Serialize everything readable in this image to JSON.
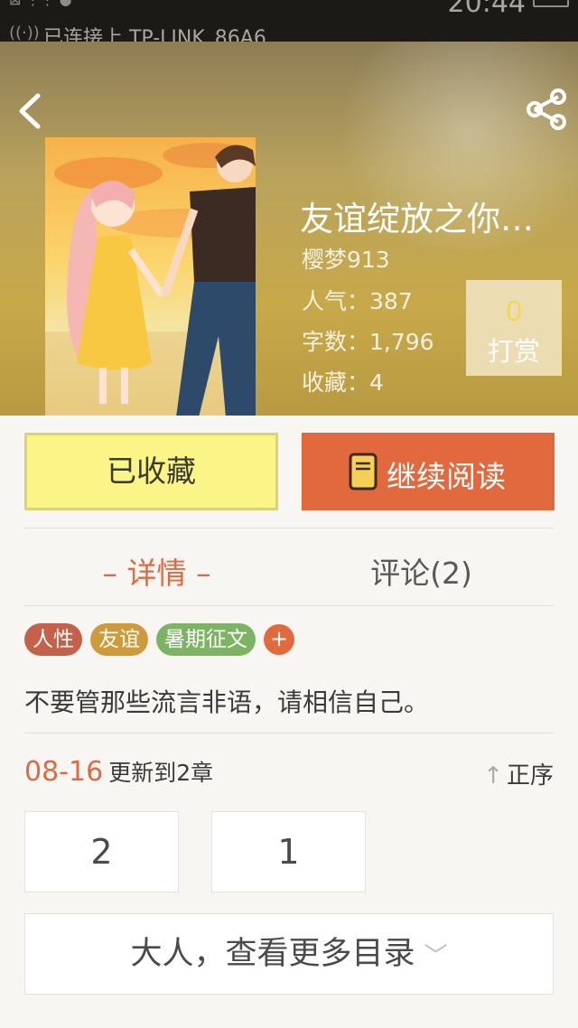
{
  "status_bar": {
    "wifi_text": "已连接上 TP-LINK_86A6",
    "time": "20:44"
  },
  "header": {
    "book_title": "友谊绽放之你…",
    "author": "樱梦913",
    "popularity_label": "人气：",
    "popularity_value": "387",
    "words_label": "字数：",
    "words_value": "1,796",
    "favorites_label": "收藏：",
    "favorites_value": "4",
    "tip_count": "0",
    "tip_label": "打赏"
  },
  "actions": {
    "collected_label": "已收藏",
    "continue_label": "继续阅读"
  },
  "tabs": {
    "details": "– 详情 –",
    "comments": "评论(2)"
  },
  "tags": [
    {
      "label": "人性",
      "color": "#c5604a"
    },
    {
      "label": "友谊",
      "color": "#cd9a3c"
    },
    {
      "label": "暑期征文",
      "color": "#7db464"
    }
  ],
  "tag_add": "+",
  "description": "不要管那些流言非语，请相信自己。",
  "update": {
    "date": "08-16",
    "text": "更新到2章",
    "sort_label": "正序"
  },
  "chapters": [
    "2",
    "1"
  ],
  "more_catalog": "大人，查看更多目录",
  "colors": {
    "accent": "#e2693d",
    "collected_bg": "#fbf486"
  }
}
